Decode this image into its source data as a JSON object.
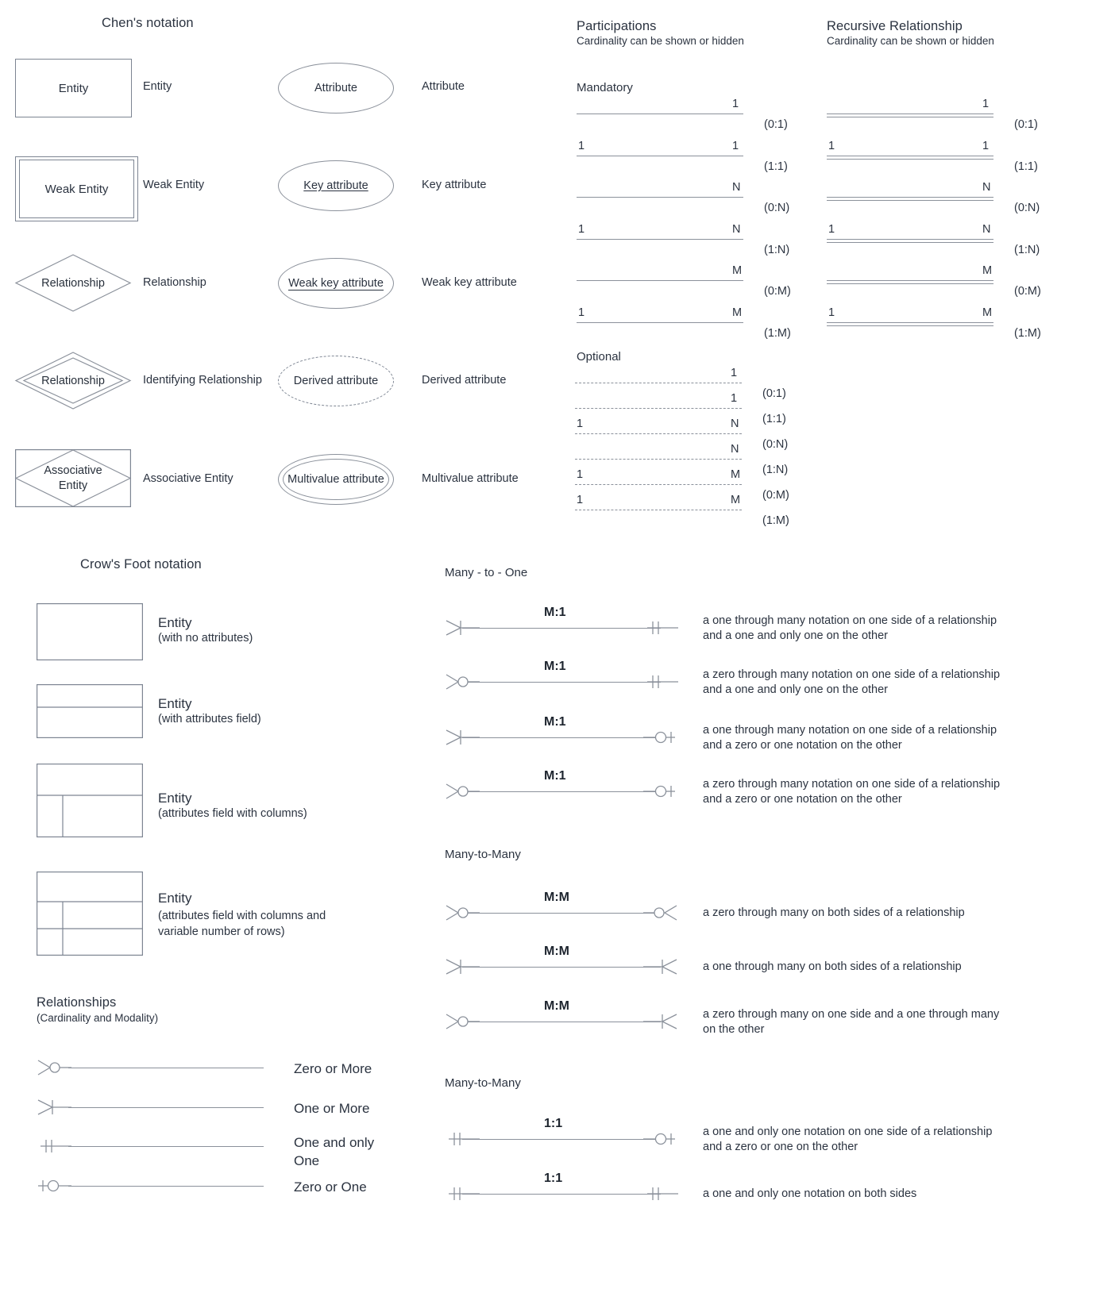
{
  "chen": {
    "title": "Chen's notation",
    "shapes": [
      {
        "inner": "Entity",
        "label": "Entity"
      },
      {
        "inner": "Weak Entity",
        "label": "Weak Entity"
      },
      {
        "inner": "Relationship",
        "label": "Relationship"
      },
      {
        "inner": "Relationship",
        "label": "Identifying Relationship"
      },
      {
        "inner": "Associative Entity",
        "label": "Associative Entity"
      }
    ],
    "attributes": [
      {
        "inner": "Attribute",
        "label": "Attribute"
      },
      {
        "inner": "Key attribute",
        "label": "Key attribute"
      },
      {
        "inner": "Weak key attribute",
        "label": "Weak key attribute"
      },
      {
        "inner": "Derived attribute",
        "label": "Derived attribute"
      },
      {
        "inner": "Multivalue attribute",
        "label": "Multivalue attribute"
      }
    ]
  },
  "participations": {
    "title": "Participations",
    "subtitle": "Cardinality can be shown or hidden",
    "mandatory_label": "Mandatory",
    "optional_label": "Optional",
    "mandatory_rows": [
      {
        "left": "",
        "right": "1",
        "card": "(0:1)"
      },
      {
        "left": "1",
        "right": "1",
        "card": "(1:1)"
      },
      {
        "left": "",
        "right": "N",
        "card": "(0:N)"
      },
      {
        "left": "1",
        "right": "N",
        "card": "(1:N)"
      },
      {
        "left": "",
        "right": "M",
        "card": "(0:M)"
      },
      {
        "left": "1",
        "right": "M",
        "card": "(1:M)"
      }
    ],
    "optional_rows": [
      {
        "left": "",
        "right": "1",
        "card": "(0:1)"
      },
      {
        "left": "",
        "right": "1",
        "card": "(1:1)"
      },
      {
        "left": "1",
        "right": "N",
        "card": "(0:N)"
      },
      {
        "left": "",
        "right": "N",
        "card": "(1:N)"
      },
      {
        "left": "1",
        "right": "M",
        "card": "(0:M)"
      },
      {
        "left": "1",
        "right": "M",
        "card": "(1:M)"
      }
    ]
  },
  "recursive": {
    "title": "Recursive Relationship",
    "subtitle": "Cardinality can be shown or hidden",
    "rows": [
      {
        "left": "",
        "right": "1",
        "card": "(0:1)"
      },
      {
        "left": "1",
        "right": "1",
        "card": "(1:1)"
      },
      {
        "left": "",
        "right": "N",
        "card": "(0:N)"
      },
      {
        "left": "1",
        "right": "N",
        "card": "(1:N)"
      },
      {
        "left": "",
        "right": "M",
        "card": "(0:M)"
      },
      {
        "left": "1",
        "right": "M",
        "card": "(1:M)"
      }
    ]
  },
  "crowsfoot": {
    "title": "Crow's Foot notation",
    "entities": [
      {
        "name": "Entity",
        "note": "(with no attributes)"
      },
      {
        "name": "Entity",
        "note": "(with attributes field)"
      },
      {
        "name": "Entity",
        "note": "(attributes field with columns)"
      },
      {
        "name": "Entity",
        "note": "(attributes field with columns and\nvariable number of rows)"
      }
    ],
    "relationships_title": "Relationships",
    "relationships_sub": "(Cardinality and Modality)",
    "modality": [
      {
        "label": "Zero or More",
        "end": "crowfoot-circle"
      },
      {
        "label": "One or More",
        "end": "crowfoot-bar"
      },
      {
        "label": "One and only\nOne",
        "end": "double-bar"
      },
      {
        "label": "Zero or One",
        "end": "bar-circle"
      }
    ]
  },
  "many_to_one": {
    "title": "Many - to - One",
    "rows": [
      {
        "cardinality": "M:1",
        "left": "crowfoot-bar",
        "right": "double-bar",
        "desc": "a one through many notation on one side of a relationship\nand a one and only one on the other"
      },
      {
        "cardinality": "M:1",
        "left": "crowfoot-circle",
        "right": "double-bar",
        "desc": "a zero through many notation on one side of a relationship\nand a one and only one on the other"
      },
      {
        "cardinality": "M:1",
        "left": "crowfoot-bar",
        "right": "circle-bar",
        "desc": "a one through many notation on one side of a relationship\nand a zero or one notation on the other"
      },
      {
        "cardinality": "M:1",
        "left": "crowfoot-circle",
        "right": "circle-bar",
        "desc": "a zero through many notation on one side of a relationship\nand a zero or one notation on the other"
      }
    ]
  },
  "many_to_many": {
    "title": "Many-to-Many",
    "rows": [
      {
        "cardinality": "M:M",
        "left": "crowfoot-circle",
        "right": "circle-crowfoot",
        "desc": "a zero through many on both sides of a relationship"
      },
      {
        "cardinality": "M:M",
        "left": "crowfoot-bar",
        "right": "bar-crowfoot",
        "desc": "a one through many on both sides of a relationship"
      },
      {
        "cardinality": "M:M",
        "left": "crowfoot-circle",
        "right": "bar-crowfoot",
        "desc": "a zero through many on one side and a one through many\non the other"
      }
    ]
  },
  "one_to_one": {
    "title": "Many-to-Many",
    "rows": [
      {
        "cardinality": "1:1",
        "left": "double-bar",
        "right": "circle-bar",
        "desc": "a one and only one notation on one side of a relationship\nand a zero or one on the other"
      },
      {
        "cardinality": "1:1",
        "left": "double-bar",
        "right": "double-bar",
        "desc": "a one and only one notation on both sides"
      }
    ]
  },
  "colors": {
    "stroke": "#8b919b",
    "text": "#2b3340",
    "box_border": "#7d8592"
  }
}
